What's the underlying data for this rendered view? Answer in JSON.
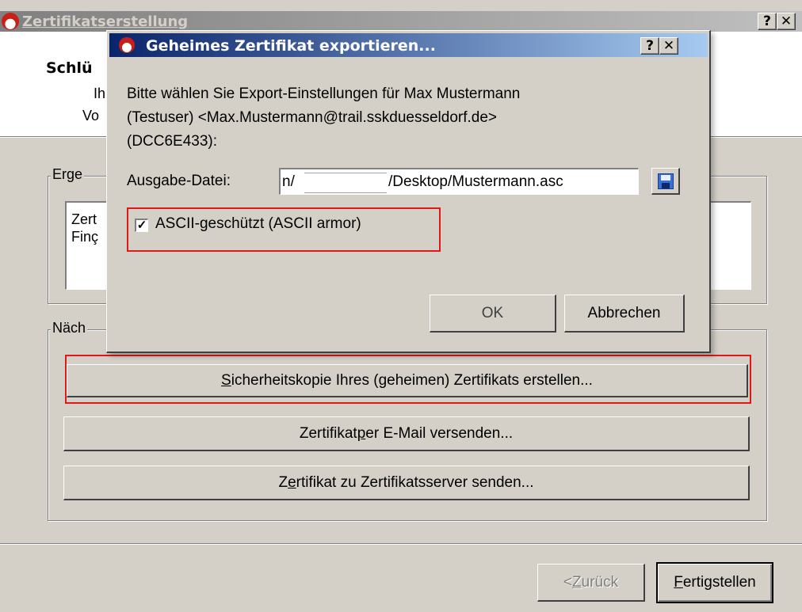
{
  "main_window": {
    "title": "Zertifikatserstellung",
    "help_glyph": "?",
    "close_glyph": "✕",
    "header": {
      "title": "Schlü",
      "line1": "Ihr",
      "line2": "Vo"
    },
    "result_group": {
      "label": "Erge",
      "text_line1": "Zert",
      "text_line2": "Finç"
    },
    "next_group": {
      "label": "Näch"
    },
    "actions": [
      {
        "prefix": "",
        "mnemonic": "S",
        "rest": "icherheitskopie Ihres (geheimen) Zertifikats erstellen..."
      },
      {
        "prefix": "Zertifikat ",
        "mnemonic": "p",
        "rest": "er E-Mail versenden..."
      },
      {
        "prefix": "Z",
        "mnemonic": "e",
        "rest": "rtifikat zu Zertifikatsserver senden..."
      }
    ],
    "back_button": {
      "prefix": "< ",
      "mnemonic": "Z",
      "rest": "urück"
    },
    "finish_button": {
      "mnemonic": "F",
      "rest": "ertigstellen"
    }
  },
  "dialog": {
    "title": "Geheimes Zertifikat exportieren...",
    "help_glyph": "?",
    "close_glyph": "✕",
    "prompt": {
      "line1": "Bitte wählen Sie Export-Einstellungen für Max Mustermann",
      "line2": "(Testuser) <Max.Mustermann@trail.sskduesseldorf.de>",
      "line3": "(DCC6E433):"
    },
    "output_label": "Ausgabe-Datei:",
    "output_path_start": "n/",
    "output_path_end": "/Desktop/Mustermann.asc",
    "save_icon": "floppy-disk-icon",
    "ascii_checkbox": {
      "checked": true,
      "check_glyph": "✓",
      "label": "ASCII-geschützt (ASCII armor)"
    },
    "ok_label": "OK",
    "cancel_label": "Abbrechen"
  },
  "colors": {
    "highlight": "#e01818",
    "dialog_title": "#0a246a",
    "face": "#d4d0c8"
  }
}
